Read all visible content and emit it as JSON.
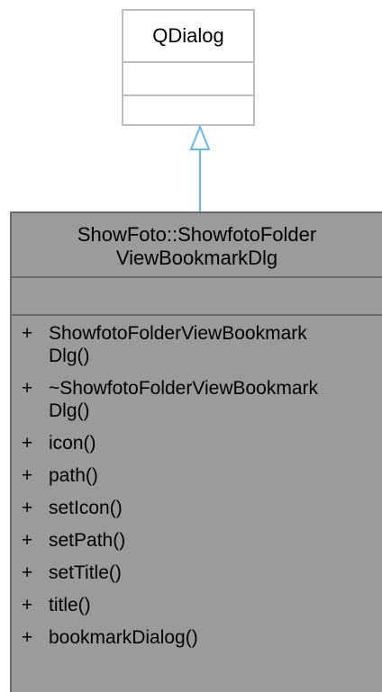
{
  "parent_class": {
    "name": "QDialog"
  },
  "class": {
    "name_line1": "ShowFoto::ShowfotoFolder",
    "name_line2": "ViewBookmarkDlg",
    "methods": [
      {
        "visibility": "+",
        "name": "ShowfotoFolderViewBookmark\nDlg()"
      },
      {
        "visibility": "+",
        "name": "~ShowfotoFolderViewBookmark\nDlg()"
      },
      {
        "visibility": "+",
        "name": "icon()"
      },
      {
        "visibility": "+",
        "name": "path()"
      },
      {
        "visibility": "+",
        "name": "setIcon()"
      },
      {
        "visibility": "+",
        "name": "setPath()"
      },
      {
        "visibility": "+",
        "name": "setTitle()"
      },
      {
        "visibility": "+",
        "name": "title()"
      },
      {
        "visibility": "+",
        "name": "bookmarkDialog()"
      }
    ]
  },
  "colors": {
    "parent_border": "#bdbdbd",
    "class_fill": "#9b9b9b",
    "class_border": "#6a6a6a",
    "arrow": "#63b8ff"
  }
}
